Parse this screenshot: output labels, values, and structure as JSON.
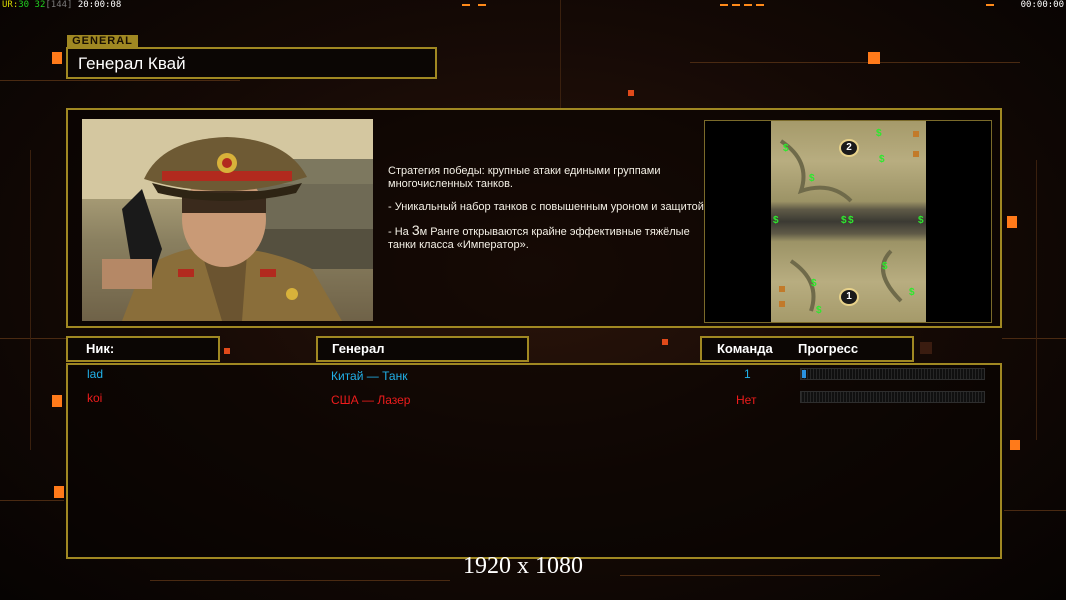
{
  "hud": {
    "ur_label": "UR:",
    "fps_a": "30",
    "fps_b": "32",
    "bracket": "[144]",
    "clock": "20:00:08",
    "right_clock": "00:00:00"
  },
  "section_tag": "GENERAL",
  "general_name": "Генерал Квай",
  "description": {
    "p1": "Стратегия победы: крупные атаки едиными группами многочисленных танков.",
    "p2": "- Уникальный набор танков с повышенным уроном и защитой.",
    "p3_prefix": "- На ",
    "p3_rank": "3",
    "p3_suffix": "м Ранге открываются крайне эффективные тяжёлые танки класса «Император»."
  },
  "minimap": {
    "start_top": "2",
    "start_bottom": "1",
    "supply_symbol": "$"
  },
  "columns": {
    "nick": "Ник:",
    "general": "Генерал",
    "team": "Команда",
    "progress": "Прогресс"
  },
  "players": [
    {
      "nick": "lad",
      "general": "Китай — Танк",
      "team": "1",
      "color": "#21b0e8",
      "progress": 0.02
    },
    {
      "nick": "koi",
      "general": "США — Лазер",
      "team": "Нет",
      "color": "#ee1c1c",
      "progress": 0
    }
  ],
  "resolution_text": "1920 x 1080",
  "colors": {
    "frame": "#a08822",
    "hud_orange": "#ff8a1a",
    "team_blue": "#21b0e8",
    "team_red": "#ee1c1c"
  }
}
